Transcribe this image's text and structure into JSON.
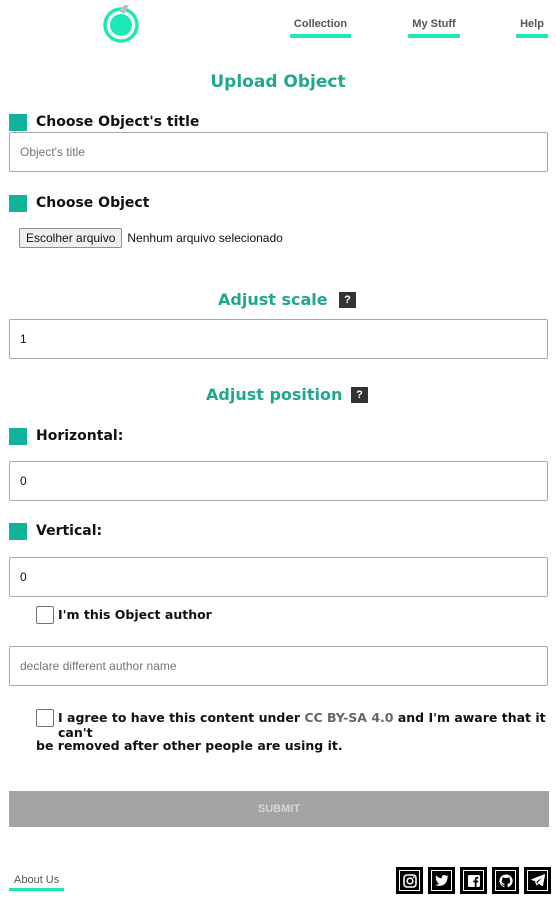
{
  "header": {
    "nav": [
      {
        "label": "Collection"
      },
      {
        "label": "My Stuff"
      },
      {
        "label": "Help"
      }
    ]
  },
  "form": {
    "title": "Upload Object",
    "object_title_label": "Choose Object's title",
    "object_title_placeholder": "Object's title",
    "object_label": "Choose Object",
    "file_button": "Escolher arquivo",
    "file_status": "Nenhum arquivo selecionado",
    "scale_title": "Adjust scale",
    "scale_help": "?",
    "scale_value": "1",
    "position_title": "Adjust position",
    "position_help": "?",
    "horizontal_label": "Horizontal:",
    "horizontal_value": "0",
    "vertical_label": "Vertical:",
    "vertical_value": "0",
    "author_checkbox_label": "I'm this Object author",
    "author_placeholder": "declare different author name",
    "agree_prefix": "I agree to have this content under ",
    "agree_license": "CC BY-SA 4.0",
    "agree_suffix_1": " and I'm aware that it can't",
    "agree_suffix_2": "be removed after other people are using it.",
    "submit_label": "SUBMIT"
  },
  "footer": {
    "about_label": "About Us",
    "social_icons": [
      "instagram-icon",
      "twitter-icon",
      "facebook-icon",
      "github-icon",
      "telegram-icon"
    ]
  },
  "colors": {
    "accent": "#1de9b6",
    "heading": "#20a88e",
    "square": "#11b39a",
    "submit_bg": "#a3a3a3"
  }
}
